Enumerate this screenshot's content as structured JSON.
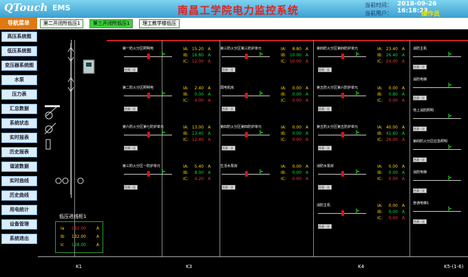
{
  "header": {
    "logo": "QTouch",
    "logo_sub": "EMS",
    "title": "南昌工学院电力监控系统",
    "time_label": "当前时间：",
    "time_value": "2018-09-26 16:18:23",
    "user_label": "当前用户：",
    "user_value": "操作员"
  },
  "tabs": [
    {
      "label": "第二开闭所低压1",
      "active": false
    },
    {
      "label": "第三开闭所低压1",
      "active": true
    },
    {
      "label": "理工教学楼低压",
      "active": false
    }
  ],
  "sidebar": {
    "title": "导航菜单",
    "items": [
      "高压系统图",
      "低压系统图",
      "变压器系统图",
      "水泵",
      "压力表",
      "汇总数据",
      "系统状态",
      "实时报表",
      "历史报表",
      "谐波数据",
      "实时曲线",
      "历史曲线",
      "用电统计",
      "设备管理",
      "系统退出"
    ]
  },
  "main": {
    "incomer": {
      "title": "低压进线柜1",
      "rows": [
        {
          "phase": "Ia",
          "value": "132.00",
          "unit": "A",
          "color": "#ff3030"
        },
        {
          "phase": "Ib",
          "value": "132.00",
          "unit": "A",
          "color": "#ffd400"
        },
        {
          "phase": "Ic",
          "value": "128.00",
          "unit": "A",
          "color": "#00e040"
        }
      ]
    },
    "feeders": [
      {
        "name": "第一防火分区照明电",
        "ia": "15.20",
        "ib": "16.80",
        "ic": "12.00"
      },
      {
        "name": "第二防火分区照明电",
        "ia": "2.40",
        "ib": "0.00",
        "ic": "4.00"
      },
      {
        "name": "第六防火分区第七防护单元",
        "ia": "13.00",
        "ib": "13.40",
        "ic": "12.40"
      },
      {
        "name": "第三防火分区一防护单元",
        "ia": "5.40",
        "ib": "8.00",
        "ic": "4.20"
      },
      {
        "name": "第三防火分区第三防护单元",
        "ia": "8.80",
        "ib": "10.00",
        "ic": "10.00"
      },
      {
        "name": "弱电机房",
        "ia": "0.00",
        "ib": "0.00",
        "ic": "0.00"
      },
      {
        "name": "第四防火分区第四防护单元",
        "ia": "0.00",
        "ib": "0.00",
        "ic": "0.00"
      },
      {
        "name": "生活水泵房",
        "ia": "0.00",
        "ib": "0.00",
        "ic": "0.00"
      },
      {
        "name": "第四防火分区第四防护单元",
        "ia": "23.40",
        "ib": "26.40",
        "ic": "24.00"
      },
      {
        "name": "第五防火分区第六防护单元",
        "ia": "0.00",
        "ib": "0.80",
        "ic": "0.00"
      },
      {
        "name": "第五防火分区第五防护单元",
        "ia": "40.00",
        "ib": "41.60",
        "ic": "26.00"
      },
      {
        "name": "消防水泵房",
        "ia": "0.00",
        "ib": "0.00",
        "ic": "0.00"
      },
      {
        "name": "消防主机",
        "ia": "0.00",
        "ib": "0.00",
        "ic": "0.00"
      }
    ],
    "right_col": [
      "消防主机",
      "消防电梯",
      "地上消防照明",
      "第四防火分区应急照明",
      "消防电梯",
      "普通电梯1"
    ],
    "small_button": "合闸一次",
    "bottom_labels": [
      "K1",
      "K3",
      "K4",
      "K5-(1-6)"
    ]
  },
  "colors": {
    "accent_red": "#e02020",
    "header_blue": "#3a9fd0",
    "ok_green": "#00e040",
    "value_yellow": "#ffd400"
  }
}
